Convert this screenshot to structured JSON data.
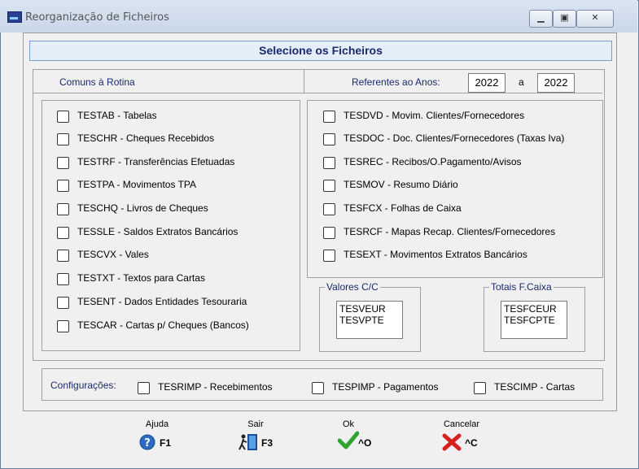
{
  "window": {
    "title": "Reorganização de Ficheiros"
  },
  "banner": {
    "title": "Selecione os Ficheiros"
  },
  "header": {
    "left_label": "Comuns à Rotina",
    "right_label": "Referentes ao Anos:",
    "year_from": "2022",
    "year_sep": "a",
    "year_to": "2022"
  },
  "left_list": [
    {
      "label": "TESTAB - Tabelas",
      "checked": false
    },
    {
      "label": "TESCHR - Cheques Recebidos",
      "checked": false
    },
    {
      "label": "TESTRF - Transferências Efetuadas",
      "checked": false
    },
    {
      "label": "TESTPA - Movimentos TPA",
      "checked": false
    },
    {
      "label": "TESCHQ - Livros de Cheques",
      "checked": false
    },
    {
      "label": "TESSLE - Saldos Extratos Bancários",
      "checked": false
    },
    {
      "label": "TESCVX - Vales",
      "checked": false
    },
    {
      "label": "TESTXT - Textos para Cartas",
      "checked": false
    },
    {
      "label": "TESENT - Dados Entidades Tesouraria",
      "checked": false
    },
    {
      "label": "TESCAR - Cartas p/ Cheques (Bancos)",
      "checked": false
    }
  ],
  "right_list": [
    {
      "label": "TESDVD - Movim. Clientes/Fornecedores",
      "checked": false
    },
    {
      "label": "TESDOC - Doc. Clientes/Fornecedores (Taxas Iva)",
      "checked": false
    },
    {
      "label": "TESREC - Recibos/O.Pagamento/Avisos",
      "checked": false
    },
    {
      "label": "TESMOV - Resumo Diário",
      "checked": false
    },
    {
      "label": "TESFCX - Folhas de Caixa",
      "checked": false
    },
    {
      "label": "TESRCF - Mapas Recap. Clientes/Fornecedores",
      "checked": false
    },
    {
      "label": "TESEXT - Movimentos Extratos Bancários",
      "checked": false
    }
  ],
  "valores": {
    "legend": "Valores C/C",
    "items": [
      "TESVEUR",
      "TESVPTE"
    ]
  },
  "totais": {
    "legend": "Totais F.Caixa",
    "items": [
      "TESFCEUR",
      "TESFCPTE"
    ]
  },
  "config": {
    "label": "Configurações:",
    "items": [
      {
        "label": "TESRIMP - Recebimentos",
        "checked": false
      },
      {
        "label": "TESPIMP - Pagamentos",
        "checked": false
      },
      {
        "label": "TESCIMP - Cartas",
        "checked": false
      }
    ]
  },
  "footer": [
    {
      "caption": "Ajuda",
      "key": "F1",
      "icon": "help-icon",
      "color": "#2a6cc4"
    },
    {
      "caption": "Sair",
      "key": "F3",
      "icon": "exit-door-icon",
      "color": "#1c4f9a"
    },
    {
      "caption": "Ok",
      "key": "^O",
      "icon": "checkmark-icon",
      "color": "#2fa52f"
    },
    {
      "caption": "Cancelar",
      "key": "^C",
      "icon": "cancel-x-icon",
      "color": "#d81f1f"
    }
  ]
}
